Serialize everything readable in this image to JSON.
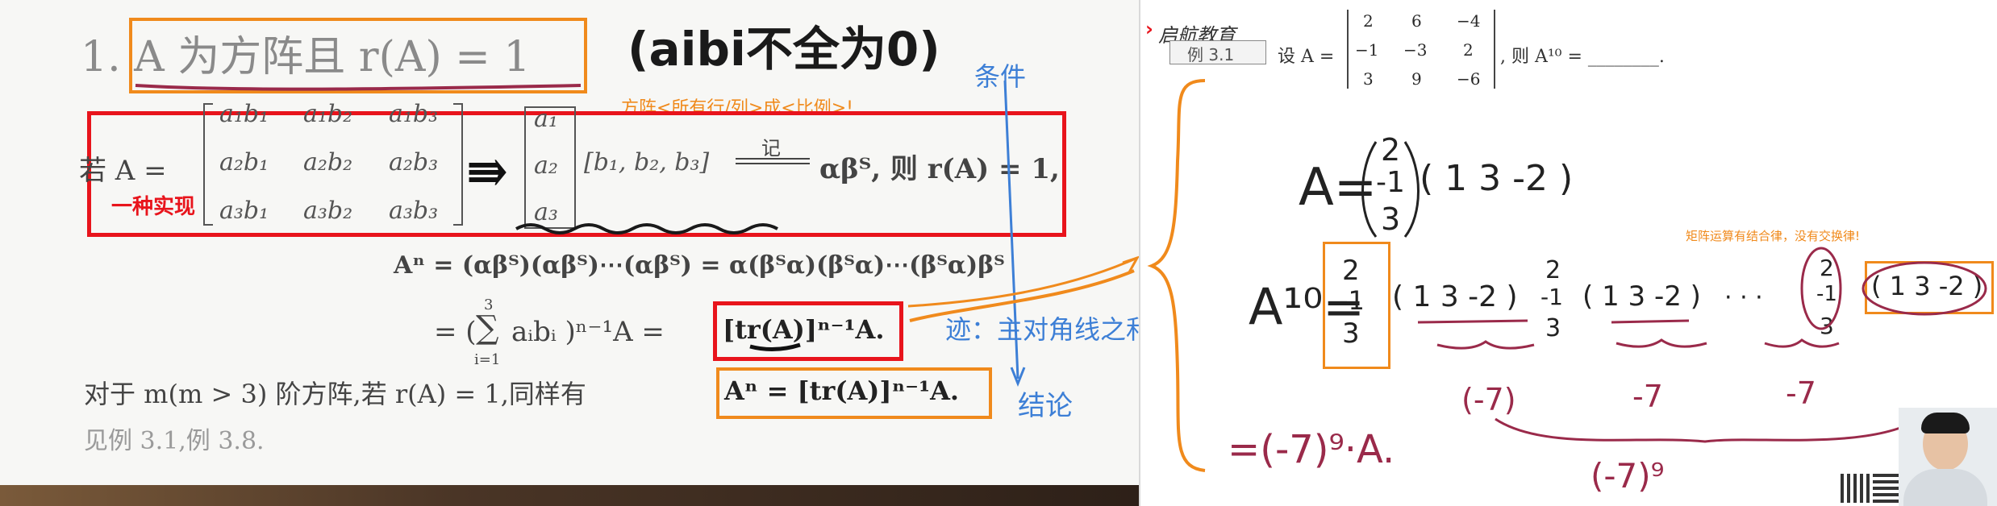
{
  "left": {
    "title": "1. A 为方阵且 r(A) = 1",
    "handwritten_note": "(aibi不全为0)",
    "label_condition": "条件",
    "orange_note": "方阵<所有行/列>成<比例>!",
    "red_label": "一种实现",
    "if_prefix": "若 A =",
    "matrix_rows": [
      [
        "a₁b₁",
        "a₁b₂",
        "a₁b₃"
      ],
      [
        "a₂b₁",
        "a₂b₂",
        "a₂b₃"
      ],
      [
        "a₃b₁",
        "a₃b₂",
        "a₃b₃"
      ]
    ],
    "col_vector": [
      "a₁",
      "a₂",
      "a₃"
    ],
    "row_vector": "[b₁, b₂, b₃]",
    "ji_label": "记",
    "alpha_beta": "αβᵀ, 则 r(A) = 1,",
    "line_power": "Aⁿ = (αβᵀ)(αβᵀ)⋯(αβᵀ) = α(βᵀα)(βᵀα)⋯(βᵀα)βᵀ",
    "line_sum_prefix": "= (",
    "line_sum_sigma": "∑",
    "line_sum_top": "3",
    "line_sum_bottom": "i=1",
    "line_sum_middle": "aᵢbᵢ )ⁿ⁻¹A =",
    "line_trace_boxed": "[tr(A)]ⁿ⁻¹A.",
    "trace_label": "迹：主对角线之和",
    "line_m_prefix": "对于 m(m > 3) 阶方阵,若 r(A) = 1,同样有",
    "line_m_boxed": "Aⁿ = [tr(A)]ⁿ⁻¹A.",
    "conclusion_label": "结论",
    "see_examples": "见例 3.1,例 3.8."
  },
  "right": {
    "brand": "启航教育",
    "example_tag": "例 3.1",
    "problem_prefix": "设 A =",
    "problem_matrix": [
      [
        "2",
        "6",
        "−4"
      ],
      [
        "−1",
        "−3",
        "2"
      ],
      [
        "3",
        "9",
        "−6"
      ]
    ],
    "problem_suffix": ", 则 A¹⁰ = ________.",
    "hw_A": "A=",
    "hw_col": [
      "2",
      "-1",
      "3"
    ],
    "hw_row": "( 1  3  -2 )",
    "hw_A10": "A¹⁰=",
    "hw_row_short": "( 1 3 -2 )",
    "hw_dots": "· · ·",
    "hw_neg7": [
      "(-7)",
      "-7",
      "-7"
    ],
    "hw_power9": "(-7)⁹",
    "hw_result": "=(-7)⁹·A.",
    "assoc_note": "矩阵运算有结合律，没有交换律!"
  },
  "colors": {
    "orange": "#f08a1c",
    "red": "#e8141c",
    "blue": "#3d7fd6",
    "maroon": "#9a2a4a",
    "pen": "#222222"
  }
}
